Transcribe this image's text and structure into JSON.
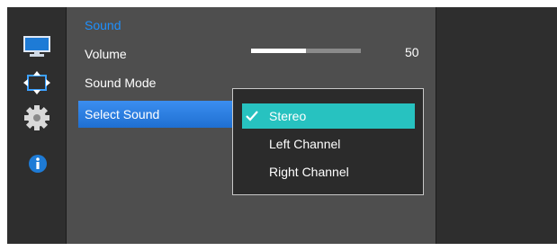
{
  "menu": {
    "title": "Sound",
    "items": [
      {
        "label": "Volume"
      },
      {
        "label": "Sound Mode"
      },
      {
        "label": "Select Sound"
      }
    ],
    "volume": {
      "value_text": "50",
      "level_percent": 50
    }
  },
  "dropdown": {
    "options": [
      {
        "label": "Stereo",
        "selected": true
      },
      {
        "label": "Left Channel",
        "selected": false
      },
      {
        "label": "Right Channel",
        "selected": false
      }
    ]
  },
  "sidebar": {
    "icons": [
      "monitor-icon",
      "move-arrows-icon",
      "gear-icon",
      "info-icon"
    ]
  },
  "colors": {
    "accent_title": "#1e90ff",
    "selected_row": "#2a7fe6",
    "selected_option": "#27c2c0",
    "panel_bg": "#4e4e4e"
  }
}
